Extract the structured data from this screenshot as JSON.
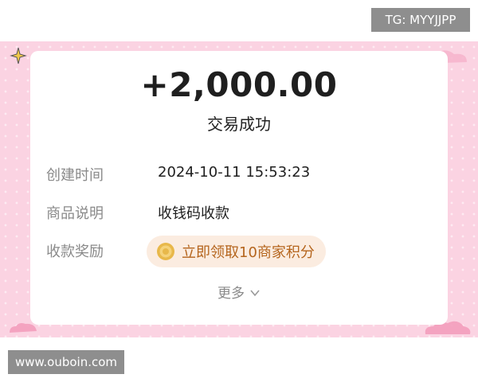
{
  "watermark": {
    "tg": "TG: MYYJJPP",
    "url": "www.ouboin.com"
  },
  "transaction": {
    "amount": "+2,000.00",
    "status": "交易成功",
    "rows": [
      {
        "label": "创建时间",
        "value": "2024-10-11 15:53:23"
      },
      {
        "label": "商品说明",
        "value": "收钱码收款"
      },
      {
        "label": "收款奖励",
        "value": "立即领取10商家积分"
      }
    ],
    "more_label": "更多"
  },
  "icons": {
    "coin": "gold-coin-icon",
    "chevron": "chevron-down-icon"
  },
  "colors": {
    "background_band": "#fbd3e2",
    "amount_text": "#1f1f1f",
    "label_text": "#8a8a8a",
    "reward_pill_bg": "#fbece0",
    "reward_text": "#b5651d",
    "watermark_bg": "#8e8e8e"
  }
}
